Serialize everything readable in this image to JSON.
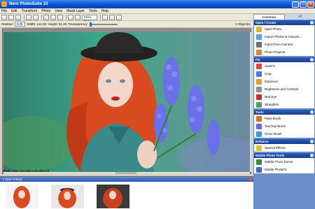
{
  "window": {
    "title": "Nero PhotoSuite 10"
  },
  "menu": [
    "File",
    "Edit",
    "Transform",
    "Photo",
    "View",
    "Mask Layer",
    "Tools",
    "Help"
  ],
  "toolbar": {
    "zoom_mode": "Fit to Page"
  },
  "properties": {
    "rotation_label": "Rotation",
    "rotation_value": "0.00",
    "width_label": "Width: 121.92",
    "height_label": "Height: 81.28",
    "transparency_label": "Transparency:",
    "object_count": "1 Object(s)"
  },
  "canvas": {
    "title": "Canvas - IMG_7165.JPG"
  },
  "status": {
    "photo_size": "Photo Size: 121.920 x 81.280 cm"
  },
  "open_files": {
    "header": "1 Open File(s)"
  },
  "side": {
    "tabs": [
      "Common",
      "All"
    ],
    "sections": [
      {
        "title": "Open / Create",
        "items": [
          {
            "label": "Open Photo",
            "icon": "folder-icon",
            "color": "#e0b030"
          },
          {
            "label": "Import Photos & Cutouts...",
            "icon": "import-icon",
            "color": "#5aa0d8"
          },
          {
            "label": "Import from Camera",
            "icon": "camera-icon",
            "color": "#707070"
          },
          {
            "label": "Photo Projects",
            "icon": "projects-icon",
            "color": "#d88a3a"
          }
        ]
      },
      {
        "title": "Fix",
        "items": [
          {
            "label": "AutoFix",
            "icon": "autofix-icon",
            "color": "#d84a4a"
          },
          {
            "label": "Crop",
            "icon": "crop-icon",
            "color": "#4a7ad8"
          },
          {
            "label": "Exposure",
            "icon": "exposure-icon",
            "color": "#e0a030"
          },
          {
            "label": "Brightness and Contrast",
            "icon": "brightness-icon",
            "color": "#909090"
          },
          {
            "label": "Red Eye",
            "icon": "red-eye-icon",
            "color": "#c03030"
          },
          {
            "label": "Straighten",
            "icon": "straighten-icon",
            "color": "#5a9a5a"
          }
        ]
      },
      {
        "title": "Tools",
        "items": [
          {
            "label": "Paint Brush",
            "icon": "paint-brush-icon",
            "color": "#d87030"
          },
          {
            "label": "Touchup Brush",
            "icon": "touchup-brush-icon",
            "color": "#6a6ad8"
          },
          {
            "label": "Clone Brush",
            "icon": "clone-brush-icon",
            "color": "#3a9ad8"
          }
        ]
      },
      {
        "title": "Enhance",
        "items": [
          {
            "label": "Special Effects",
            "icon": "special-effects-icon",
            "color": "#e0c030"
          }
        ]
      },
      {
        "title": "Mobile Photo Tools",
        "items": [
          {
            "label": "Mobile Photo Doctor",
            "icon": "mobile-doctor-icon",
            "color": "#3a8a3a"
          },
          {
            "label": "Mobile PhotoFit",
            "icon": "mobile-photofit-icon",
            "color": "#3a6ac0"
          }
        ]
      }
    ]
  }
}
